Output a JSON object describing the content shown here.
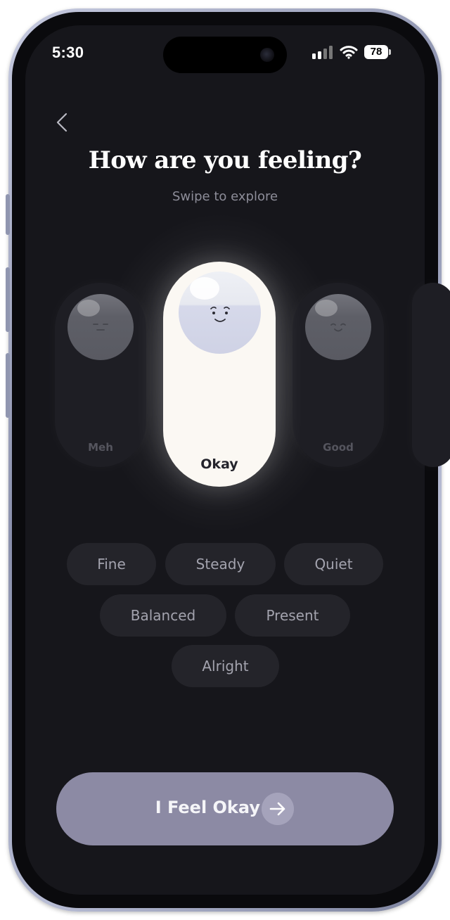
{
  "status_bar": {
    "time": "5:30",
    "battery": "78",
    "icons": [
      "cellular-signal-icon",
      "wifi-icon",
      "battery-icon"
    ]
  },
  "header": {
    "back_icon": "chevron-left-icon",
    "title": "How are you feeling?",
    "subtitle": "Swipe to explore"
  },
  "moods": {
    "left": {
      "label": "Meh"
    },
    "center": {
      "label": "Okay",
      "selected": true
    },
    "right": {
      "label": "Good"
    }
  },
  "feeling_chips": [
    "Fine",
    "Steady",
    "Quiet",
    "Balanced",
    "Present",
    "Alright"
  ],
  "cta": {
    "label": "I Feel Okay",
    "icon": "arrow-right-icon"
  },
  "colors": {
    "screen_bg": "#16161b",
    "card_active": "#fbf8f3",
    "chip_bg": "#24242a",
    "cta_bg": "#8c8aa4"
  }
}
